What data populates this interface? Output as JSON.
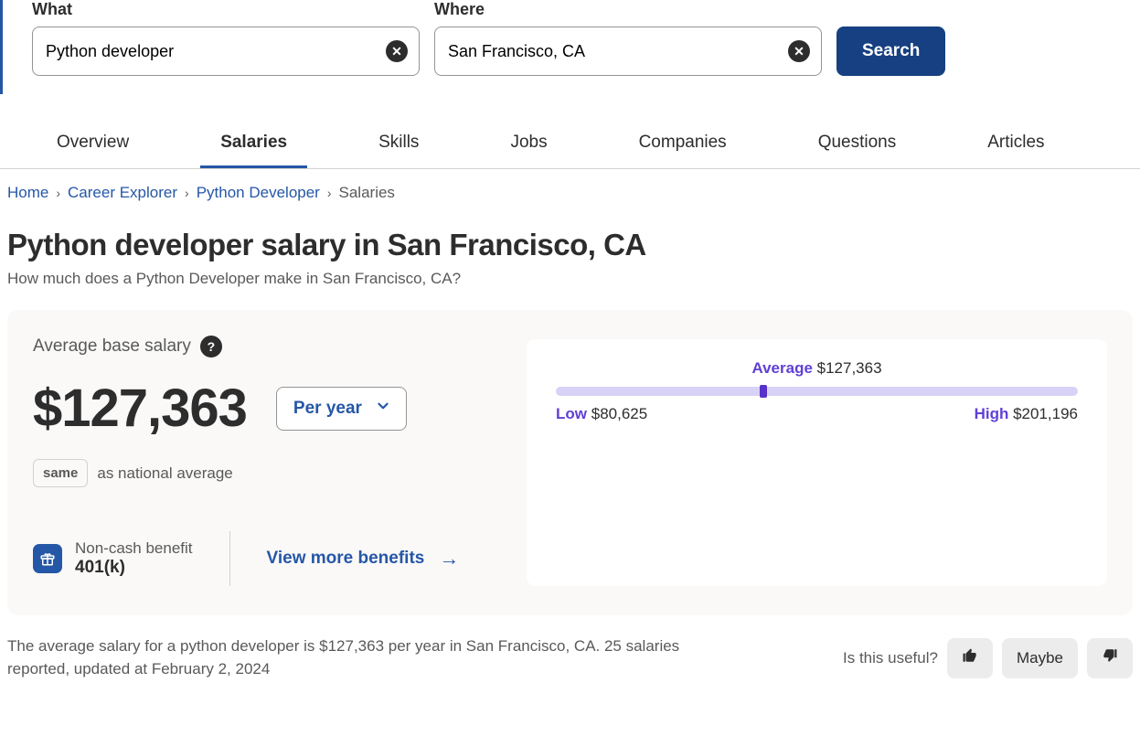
{
  "search": {
    "what_label": "What",
    "what_value": "Python developer",
    "where_label": "Where",
    "where_value": "San Francisco, CA",
    "button": "Search"
  },
  "tabs": [
    "Overview",
    "Salaries",
    "Skills",
    "Jobs",
    "Companies",
    "Questions",
    "Articles"
  ],
  "active_tab_index": 1,
  "breadcrumb": {
    "items": [
      "Home",
      "Career Explorer",
      "Python Developer"
    ],
    "current": "Salaries"
  },
  "title": "Python developer salary in San Francisco, CA",
  "subtitle": "How much does a Python Developer make in San Francisco, CA?",
  "salary": {
    "label": "Average base salary",
    "amount": "$127,363",
    "period": "Per year",
    "comparison_badge": "same",
    "comparison_text": "as national average"
  },
  "benefit": {
    "label": "Non-cash benefit",
    "value": "401(k)",
    "view_more": "View more benefits"
  },
  "range": {
    "avg_label": "Average",
    "avg_value": "$127,363",
    "low_label": "Low",
    "low_value": "$80,625",
    "high_label": "High",
    "high_value": "$201,196",
    "tick_percent": 39
  },
  "footer": "The average salary for a python developer is $127,363 per year in San Francisco, CA.  25 salaries reported, updated at February 2, 2024",
  "feedback": {
    "question": "Is this useful?",
    "maybe": "Maybe"
  }
}
